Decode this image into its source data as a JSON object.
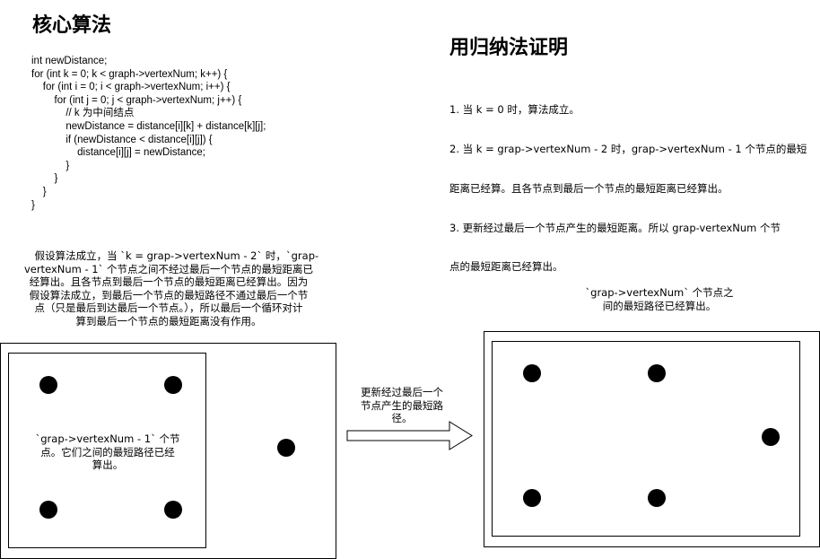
{
  "left": {
    "title": "核心算法",
    "code": "int newDistance;\nfor (int k = 0; k < graph->vertexNum; k++) {\n    for (int i = 0; i < graph->vertexNum; i++) {\n        for (int j = 0; j < graph->vertexNum; j++) {\n            // k 为中间结点\n            newDistance = distance[i][k] + distance[k][j];\n            if (newDistance < distance[i][j]) {\n                distance[i][j] = newDistance;\n            }\n        }\n    }\n}",
    "paragraph": "    假设算法成立，当 `k = grap->vertexNum - 2` 时，`grap-\nvertexNum - 1` 个节点之间不经过最后一个节点的最短距离已\n经算出。且各节点到最后一个节点的最短距离已经算出。因为\n假设算法成立，到最后一个节点的最短路径不通过最后一个节\n点（只是最后到达最后一个节点。），所以最后一个循环对计\n算到最后一个节点的最短距离没有作用。",
    "inner_label": "`grap->vertexNum - 1` 个节\n点。它们之间的最短路径已经\n算出。"
  },
  "right": {
    "title": "用归纳法证明",
    "proof_lines": [
      "1. 当 k = 0 时，算法成立。",
      "2. 当 k = grap->vertexNum - 2 时，grap->vertexNum - 1 个节点的最短",
      "距离已经算。且各节点到最后一个节点的最短距离已经算出。",
      "3. 更新经过最后一个节点产生的最短距离。所以 grap-vertexNum 个节",
      "点的最短距离已经算出。"
    ],
    "caption": "`grap->vertexNum` 个节点之\n间的最短路径已经算出。"
  },
  "arrow_label": "更新经过最后一个\n节点产生的最短路\n径。",
  "colors": {
    "stroke": "#000000",
    "node": "#000000",
    "background": "#ffffff"
  }
}
